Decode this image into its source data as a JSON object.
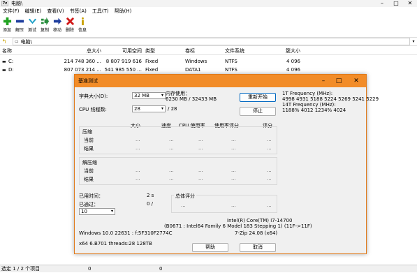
{
  "window": {
    "app_icon": "7z",
    "title": "电脑\\"
  },
  "menu": [
    "文件(F)",
    "编辑(E)",
    "查看(V)",
    "书签(A)",
    "工具(T)",
    "帮助(H)"
  ],
  "toolbar": [
    {
      "label": "添加",
      "icon": "plus-icon",
      "color": "#22a322"
    },
    {
      "label": "解压",
      "icon": "minus-icon",
      "color": "#1f3f9f"
    },
    {
      "label": "测试",
      "icon": "checkmark-icon",
      "color": "#1c9fc7"
    },
    {
      "label": "复制",
      "icon": "copy-arrow-icon",
      "color": "#2a8f3f"
    },
    {
      "label": "移动",
      "icon": "move-arrow-icon",
      "color": "#1f3f9f"
    },
    {
      "label": "删除",
      "icon": "delete-x-icon",
      "color": "#d01818"
    },
    {
      "label": "信息",
      "icon": "info-icon",
      "color": "#c8a000"
    }
  ],
  "address": {
    "path": "电脑\\"
  },
  "columns": [
    "名称",
    "总大小",
    "可用空间",
    "类型",
    "卷标",
    "文件系统",
    "簇大小"
  ],
  "drives": [
    {
      "name": "C:",
      "total": "214 748 360 ...",
      "free": "8 807 919 616",
      "type": "Fixed",
      "label": "Windows",
      "fs": "NTFS",
      "cluster": "4 096"
    },
    {
      "name": "D:",
      "total": "807 073 214 ...",
      "free": "541 985 550 ...",
      "type": "Fixed",
      "label": "DATA1",
      "fs": "NTFS",
      "cluster": "4 096"
    }
  ],
  "status": {
    "selection": "选定 1 / 2 个项目",
    "v1": "0",
    "v2": "0"
  },
  "dialog": {
    "title": "基准测试",
    "dict_label": "字典大小(D):",
    "dict_value": "32 MB",
    "threads_label": "CPU 线程数:",
    "threads_value": "28",
    "threads_total": "/ 28",
    "mem_label": "内存使用：",
    "mem_value": "6230 MB / 32433 MB",
    "restart_btn": "重新开始",
    "stop_btn": "停止",
    "freq_line1": "1T Frequency (MHz):",
    "freq_line2": "4998 4931 5188 5224 5269 5241 5229",
    "freq_line3": "14T Frequency (MHz):",
    "freq_line4": "1188% 4012 1234% 4024",
    "hdr_size": "大小",
    "hdr_speed": "速度",
    "hdr_cpu": "CPU 使用率",
    "hdr_rating_usage": "使用率评分",
    "hdr_rating": "评分",
    "compress": "压缩",
    "decompress": "解压缩",
    "current": "当前",
    "result": "结果",
    "ellipsis": "...",
    "elapsed_label": "已用时间：",
    "elapsed_value": "2 s",
    "passes_label": "已通过：",
    "passes_value": "0 /",
    "passes_combo": "10",
    "total_label": "总体评分",
    "cpu_name": "Intel(R) Core(TM) i7-14700",
    "cpu_id": "(B0671 : Intel64 Family 6 Model 183 Stepping 1) (11F->11F)",
    "version": "7-Zip 24.08 (x64)",
    "os": "Windows 10.0 22631 : f:5F310F2774C",
    "arch": "x64 6.B701 threads:28 128TB",
    "help_btn": "帮助",
    "cancel_btn": "取消"
  }
}
